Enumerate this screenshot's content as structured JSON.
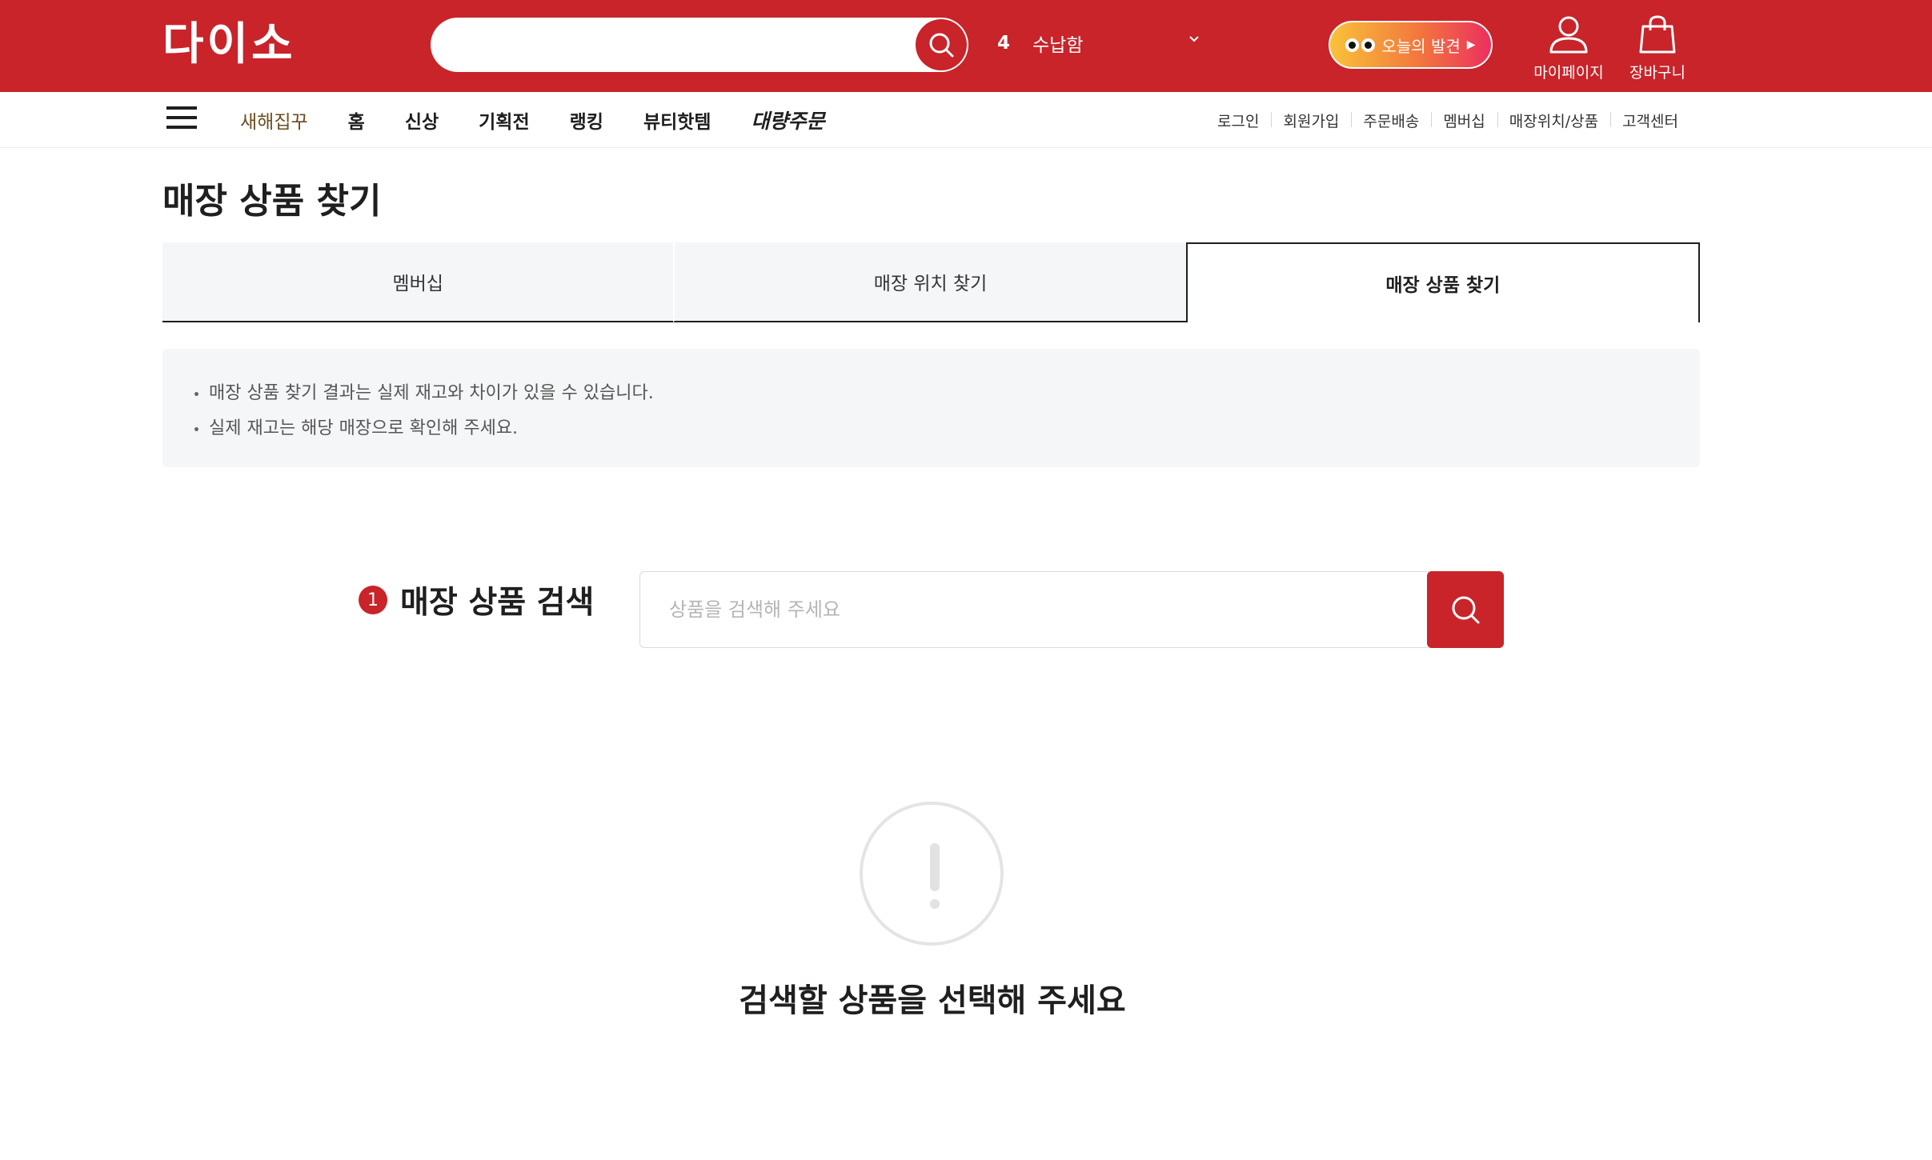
{
  "header": {
    "logo": "다이소",
    "search_value": "",
    "ranking": {
      "number": "4",
      "keyword": "수납함"
    },
    "today_button": "오늘의 발견",
    "mypage": "마이페이지",
    "cart": "장바구니"
  },
  "gnb": {
    "items": [
      "새해집꾸",
      "홈",
      "신상",
      "기획전",
      "랭킹",
      "뷰티핫템",
      "대량주문"
    ],
    "util": [
      "로그인",
      "회원가입",
      "주문배송",
      "멤버십",
      "매장위치/상품",
      "고객센터"
    ]
  },
  "page": {
    "title": "매장 상품 찾기",
    "tabs": [
      "멤버십",
      "매장 위치 찾기",
      "매장 상품 찾기"
    ],
    "notices": [
      "매장 상품 찾기 결과는 실제 재고와 차이가 있을 수 있습니다.",
      "실제 재고는 해당 매장으로 확인해 주세요."
    ],
    "step": {
      "number": "1",
      "title": "매장 상품 검색"
    },
    "search": {
      "placeholder": "상품을 검색해 주세요",
      "value": ""
    },
    "empty_message": "검색할 상품을 선택해 주세요"
  },
  "colors": {
    "brand": "#c8242a",
    "panel": "#f5f6f8"
  },
  "icons": [
    "search-icon",
    "chevron-down-icon",
    "user-icon",
    "bag-icon",
    "menu-icon",
    "exclamation-icon"
  ]
}
